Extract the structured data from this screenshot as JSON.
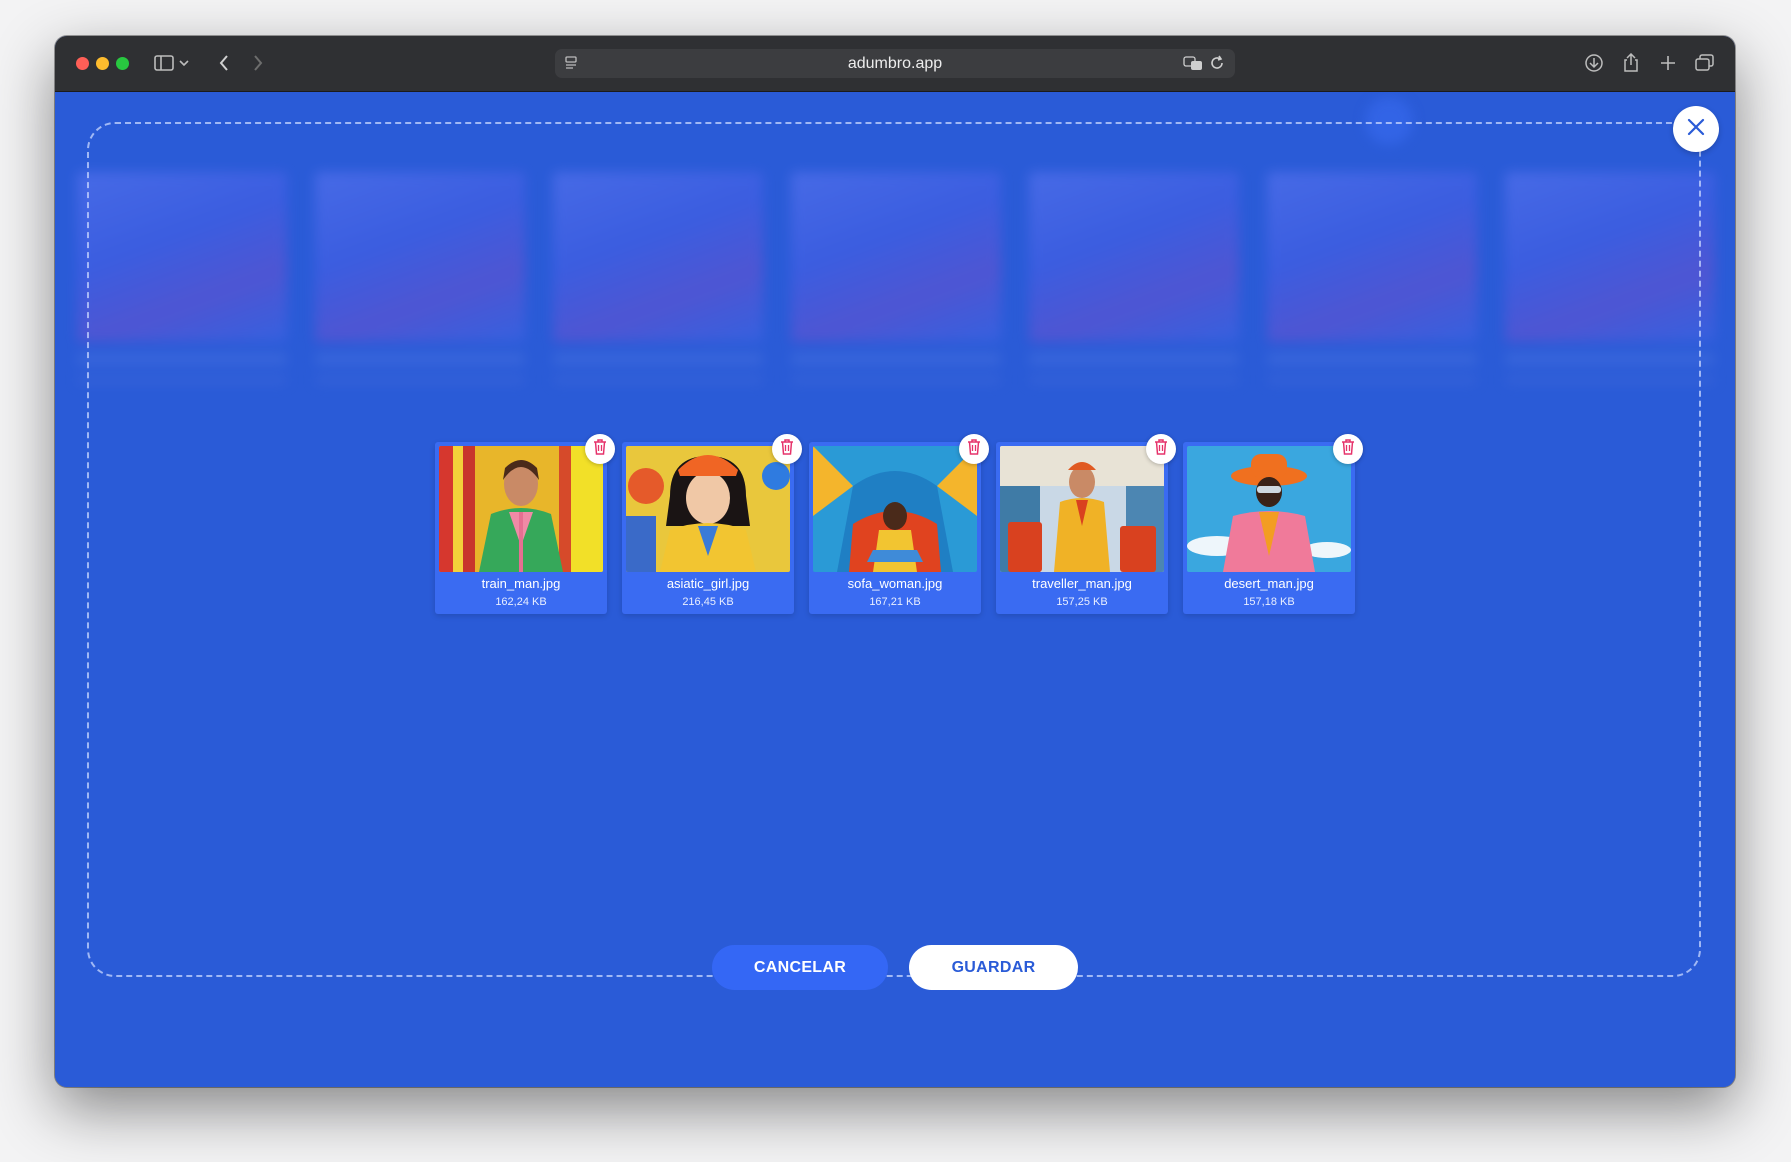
{
  "browser": {
    "url": "adumbro.app"
  },
  "dialog": {
    "files": [
      {
        "name": "train_man.jpg",
        "size": "162,24 KB"
      },
      {
        "name": "asiatic_girl.jpg",
        "size": "216,45 KB"
      },
      {
        "name": "sofa_woman.jpg",
        "size": "167,21 KB"
      },
      {
        "name": "traveller_man.jpg",
        "size": "157,25 KB"
      },
      {
        "name": "desert_man.jpg",
        "size": "157,18 KB"
      }
    ],
    "cancel_label": "CANCELAR",
    "save_label": "GUARDAR"
  },
  "colors": {
    "accent": "#2a5bd7",
    "trash_icon": "#e6336b"
  },
  "icons": {
    "close": "close-icon",
    "delete": "trash-icon"
  }
}
